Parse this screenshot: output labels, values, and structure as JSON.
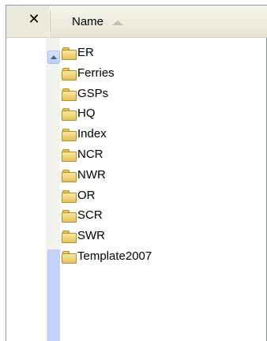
{
  "header": {
    "close_glyph": "✕",
    "name_column_label": "Name",
    "sort_direction": "ascending"
  },
  "files": [
    {
      "name": "ER",
      "icon": "folder-icon"
    },
    {
      "name": "Ferries",
      "icon": "folder-icon"
    },
    {
      "name": "GSPs",
      "icon": "folder-icon"
    },
    {
      "name": "HQ",
      "icon": "folder-icon"
    },
    {
      "name": "Index",
      "icon": "folder-icon"
    },
    {
      "name": "NCR",
      "icon": "folder-icon"
    },
    {
      "name": "NWR",
      "icon": "folder-icon"
    },
    {
      "name": "OR",
      "icon": "folder-icon"
    },
    {
      "name": "SCR",
      "icon": "folder-icon"
    },
    {
      "name": "SWR",
      "icon": "folder-icon"
    },
    {
      "name": "Template2007",
      "icon": "folder-icon"
    }
  ],
  "colors": {
    "header_bg": "#ebeadb",
    "frame": "#7f9db9",
    "scroll_thumb": "#c1d3fb",
    "folder_fill": "#f5d97a",
    "folder_outline": "#b58d2a"
  }
}
